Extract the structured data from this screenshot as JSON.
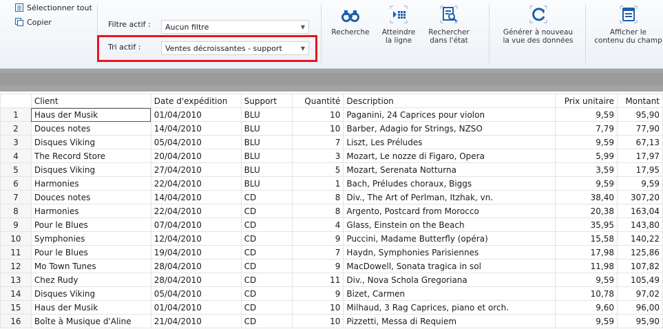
{
  "ribbon": {
    "select_all": "Sélectionner tout",
    "copy": "Copier",
    "filter_label": "Filtre actif :",
    "filter_value": "Aucun filtre",
    "sort_label": "Tri actif :",
    "sort_value": "Ventes décroissantes - support",
    "buttons": {
      "search": "Recherche",
      "goto_line_1": "Atteindre",
      "goto_line_2": "la ligne",
      "find_report_1": "Rechercher",
      "find_report_2": "dans l'état",
      "regenerate_1": "Générer à nouveau",
      "regenerate_2": "la vue des données",
      "show_field_1": "Afficher le",
      "show_field_2": "contenu du champ"
    }
  },
  "table": {
    "headers": [
      "Client",
      "Date d'expédition",
      "Support",
      "Quantité",
      "Description",
      "Prix unitaire",
      "Montant"
    ],
    "rows": [
      [
        "1",
        "Haus der Musik",
        "01/04/2010",
        "BLU",
        "10",
        "Paganini, 24 Caprices pour violon",
        "9,59",
        "95,90"
      ],
      [
        "2",
        "Douces notes",
        "14/04/2010",
        "BLU",
        "10",
        "Barber, Adagio for Strings, NZSO",
        "7,79",
        "77,90"
      ],
      [
        "3",
        "Disques Viking",
        "05/04/2010",
        "BLU",
        "7",
        "Liszt, Les Préludes",
        "9,59",
        "67,13"
      ],
      [
        "4",
        "The Record Store",
        "20/04/2010",
        "BLU",
        "3",
        "Mozart, Le nozze di Figaro, Opera",
        "5,99",
        "17,97"
      ],
      [
        "5",
        "Disques Viking",
        "27/04/2010",
        "BLU",
        "5",
        "Mozart, Serenata Notturna",
        "3,59",
        "17,95"
      ],
      [
        "6",
        "Harmonies",
        "22/04/2010",
        "BLU",
        "1",
        "Bach, Préludes choraux, Biggs",
        "9,59",
        "9,59"
      ],
      [
        "7",
        "Douces notes",
        "14/04/2010",
        "CD",
        "8",
        "Div., The Art of Perlman, Itzhak, vn.",
        "38,40",
        "307,20"
      ],
      [
        "8",
        "Harmonies",
        "22/04/2010",
        "CD",
        "8",
        "Argento, Postcard from Morocco",
        "20,38",
        "163,04"
      ],
      [
        "9",
        "Pour le Blues",
        "07/04/2010",
        "CD",
        "4",
        "Glass, Einstein on the Beach",
        "35,95",
        "143,80"
      ],
      [
        "10",
        "Symphonies",
        "12/04/2010",
        "CD",
        "9",
        "Puccini, Madame Butterfly (opéra)",
        "15,58",
        "140,22"
      ],
      [
        "11",
        "Pour le Blues",
        "19/04/2010",
        "CD",
        "7",
        "Haydn, Symphonies Parisiennes",
        "17,98",
        "125,86"
      ],
      [
        "12",
        "Mo Town Tunes",
        "28/04/2010",
        "CD",
        "9",
        "MacDowell, Sonata tragica in sol",
        "11,98",
        "107,82"
      ],
      [
        "13",
        "Chez Rudy",
        "28/04/2010",
        "CD",
        "11",
        "Div., Nova Schola Gregoriana",
        "9,59",
        "105,49"
      ],
      [
        "14",
        "Disques Viking",
        "05/04/2010",
        "CD",
        "9",
        "Bizet, Carmen",
        "10,78",
        "97,02"
      ],
      [
        "15",
        "Haus der Musik",
        "01/04/2010",
        "CD",
        "10",
        "Milhaud, 3 Rag Caprices, piano et orch.",
        "9,60",
        "96,00"
      ],
      [
        "16",
        "Boîte à Musique d'Aline",
        "21/04/2010",
        "CD",
        "10",
        "Pizzetti, Messa di Requiem",
        "9,59",
        "95,90"
      ]
    ]
  },
  "colors": {
    "highlight_border": "#e8131c",
    "icon_blue": "#1d5fa8",
    "ribbon_bg": "#edf1f6",
    "grey_bar": "#a3a3a3"
  }
}
